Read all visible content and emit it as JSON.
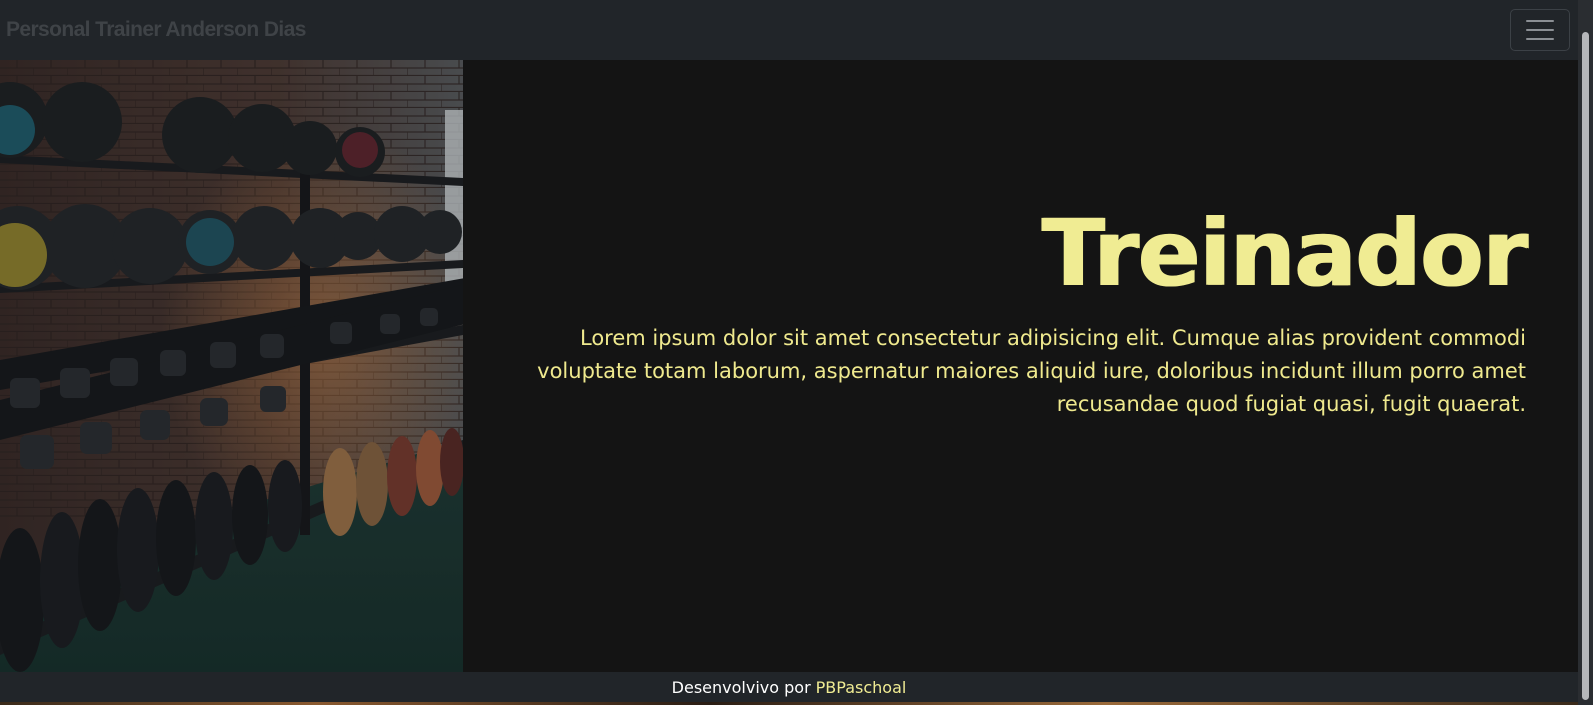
{
  "navbar": {
    "brand": "Personal Trainer Anderson Dias",
    "toggler_icon": "hamburger-icon"
  },
  "hero": {
    "image_alt": "gym-storage-photo",
    "title": "Treinador",
    "text": "Lorem ipsum dolor sit amet consectetur adipisicing elit. Cumque alias provident commodi voluptate totam laborum, aspernatur maiores aliquid iure, doloribus incidunt illum porro amet recusandae quod fugiat quasi, fugit quaerat."
  },
  "footer": {
    "prefix": "Desenvolvivo por",
    "link": "PBPaschoal"
  },
  "colors": {
    "accent": "#f0ec93",
    "navbar_bg": "#212529",
    "page_bg": "#141414"
  }
}
